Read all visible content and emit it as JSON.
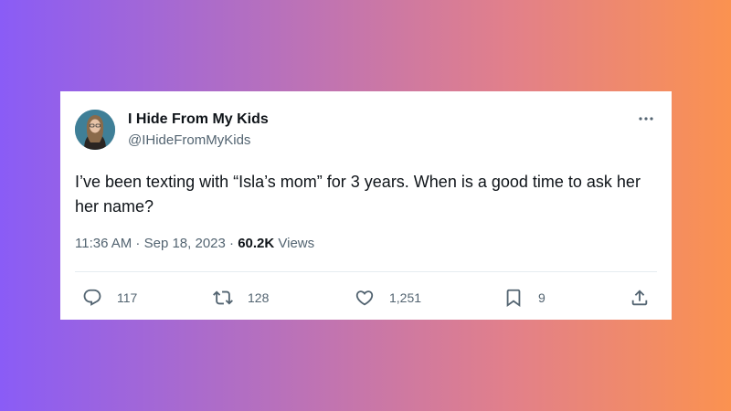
{
  "author": {
    "name": "I Hide From My Kids",
    "handle": "@IHideFromMyKids"
  },
  "tweet": {
    "text": "I’ve been texting with “Isla’s mom” for 3 years. When is a good time to ask her her name?"
  },
  "meta": {
    "time": "11:36 AM",
    "separator1": " · ",
    "date": "Sep 18, 2023",
    "separator2": " · ",
    "views_count": "60.2K",
    "views_label": " Views"
  },
  "actions": {
    "reply": {
      "icon": "reply-icon",
      "count": "117"
    },
    "retweet": {
      "icon": "retweet-icon",
      "count": "128"
    },
    "like": {
      "icon": "heart-icon",
      "count": "1,251"
    },
    "bookmark": {
      "icon": "bookmark-icon",
      "count": "9"
    },
    "share": {
      "icon": "share-icon"
    }
  },
  "colors": {
    "text_primary": "#0f1419",
    "text_secondary": "#536471",
    "icon": "#536471",
    "card_background": "#ffffff",
    "gradient_start": "#8a5cf6",
    "gradient_end": "#fb9250"
  }
}
